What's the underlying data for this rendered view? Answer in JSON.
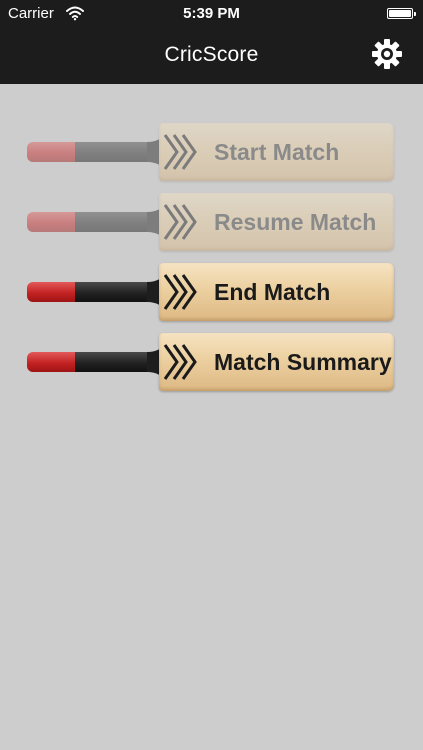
{
  "status_bar": {
    "carrier": "Carrier",
    "time": "5:39 PM"
  },
  "nav": {
    "title": "CricScore"
  },
  "menu": [
    {
      "label": "Start Match",
      "enabled": false
    },
    {
      "label": "Resume Match",
      "enabled": false
    },
    {
      "label": "End Match",
      "enabled": true
    },
    {
      "label": "Match Summary",
      "enabled": true
    }
  ],
  "colors": {
    "nav_background": "#1c1c1c",
    "page_background": "#cdcdcd",
    "grip_red": "#c42222",
    "blade": "#ecd0a0"
  },
  "icons": {
    "settings": "gear-icon",
    "wifi": "wifi-icon",
    "battery": "battery-icon"
  }
}
